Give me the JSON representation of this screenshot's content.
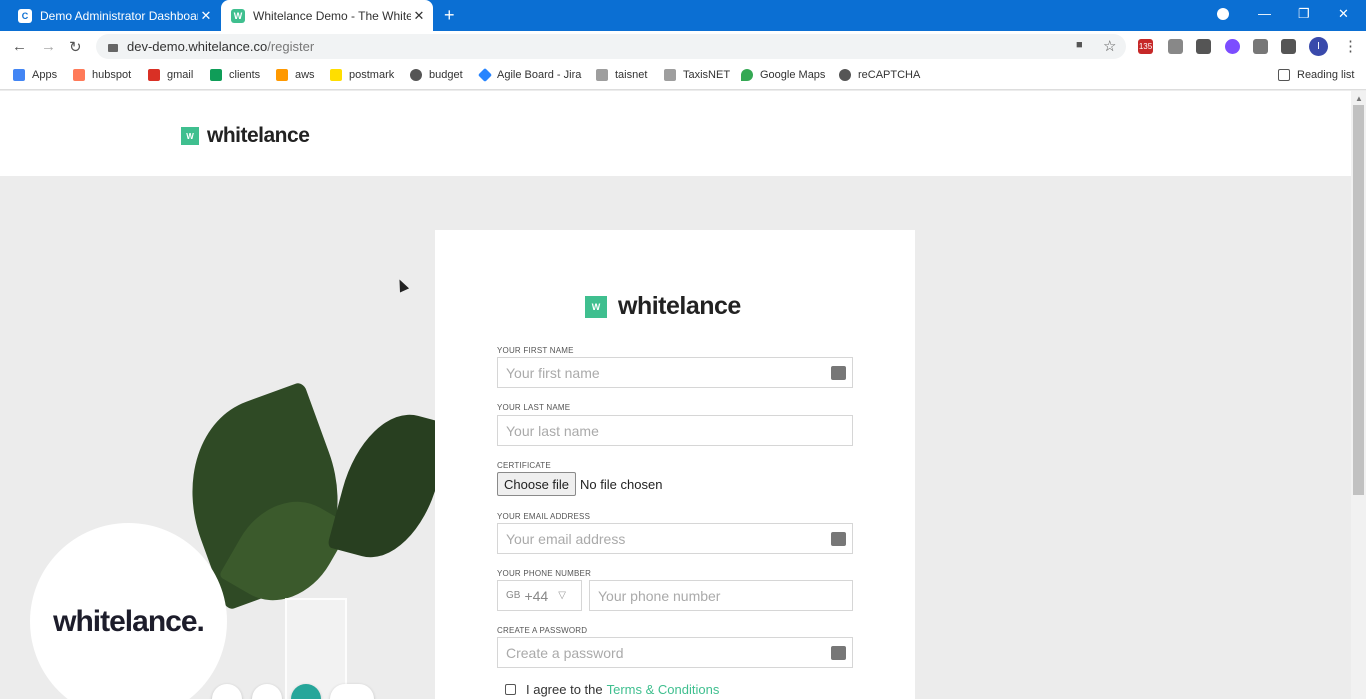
{
  "browser": {
    "tabs": [
      {
        "title": "Demo Administrator Dashboard",
        "favicon": "C"
      },
      {
        "title": "Whitelance Demo - The White La",
        "favicon": "W"
      }
    ],
    "url_domain": "dev-demo.whitelance.co",
    "url_path": "/register",
    "bookmarks": [
      "Apps",
      "hubspot",
      "gmail",
      "clients",
      "aws",
      "postmark",
      "budget",
      "Agile Board - Jira",
      "taisnet",
      "TaxisNET",
      "Google Maps",
      "reCAPTCHA"
    ],
    "reading_list": "Reading list",
    "extension_badge": "135",
    "profile_initial": "I"
  },
  "site": {
    "logo_mark": "W",
    "logo_text": "whitelance",
    "hero_logo_text": "whitelance."
  },
  "form": {
    "first_name": {
      "label": "YOUR FIRST NAME",
      "placeholder": "Your first name"
    },
    "last_name": {
      "label": "YOUR LAST NAME",
      "placeholder": "Your last name"
    },
    "certificate": {
      "label": "CERTIFICATE",
      "button": "Choose file",
      "status": "No file chosen"
    },
    "email": {
      "label": "YOUR EMAIL ADDRESS",
      "placeholder": "Your email address"
    },
    "phone": {
      "label": "YOUR PHONE NUMBER",
      "country": "GB",
      "code": "+44",
      "placeholder": "Your phone number"
    },
    "password": {
      "label": "CREATE A PASSWORD",
      "placeholder": "Create a password"
    },
    "terms": {
      "prefix": "I agree to the",
      "link": "Terms & Conditions"
    }
  },
  "colors": {
    "brand": "#3fbf8f",
    "tabbar": "#0b6fd3"
  }
}
